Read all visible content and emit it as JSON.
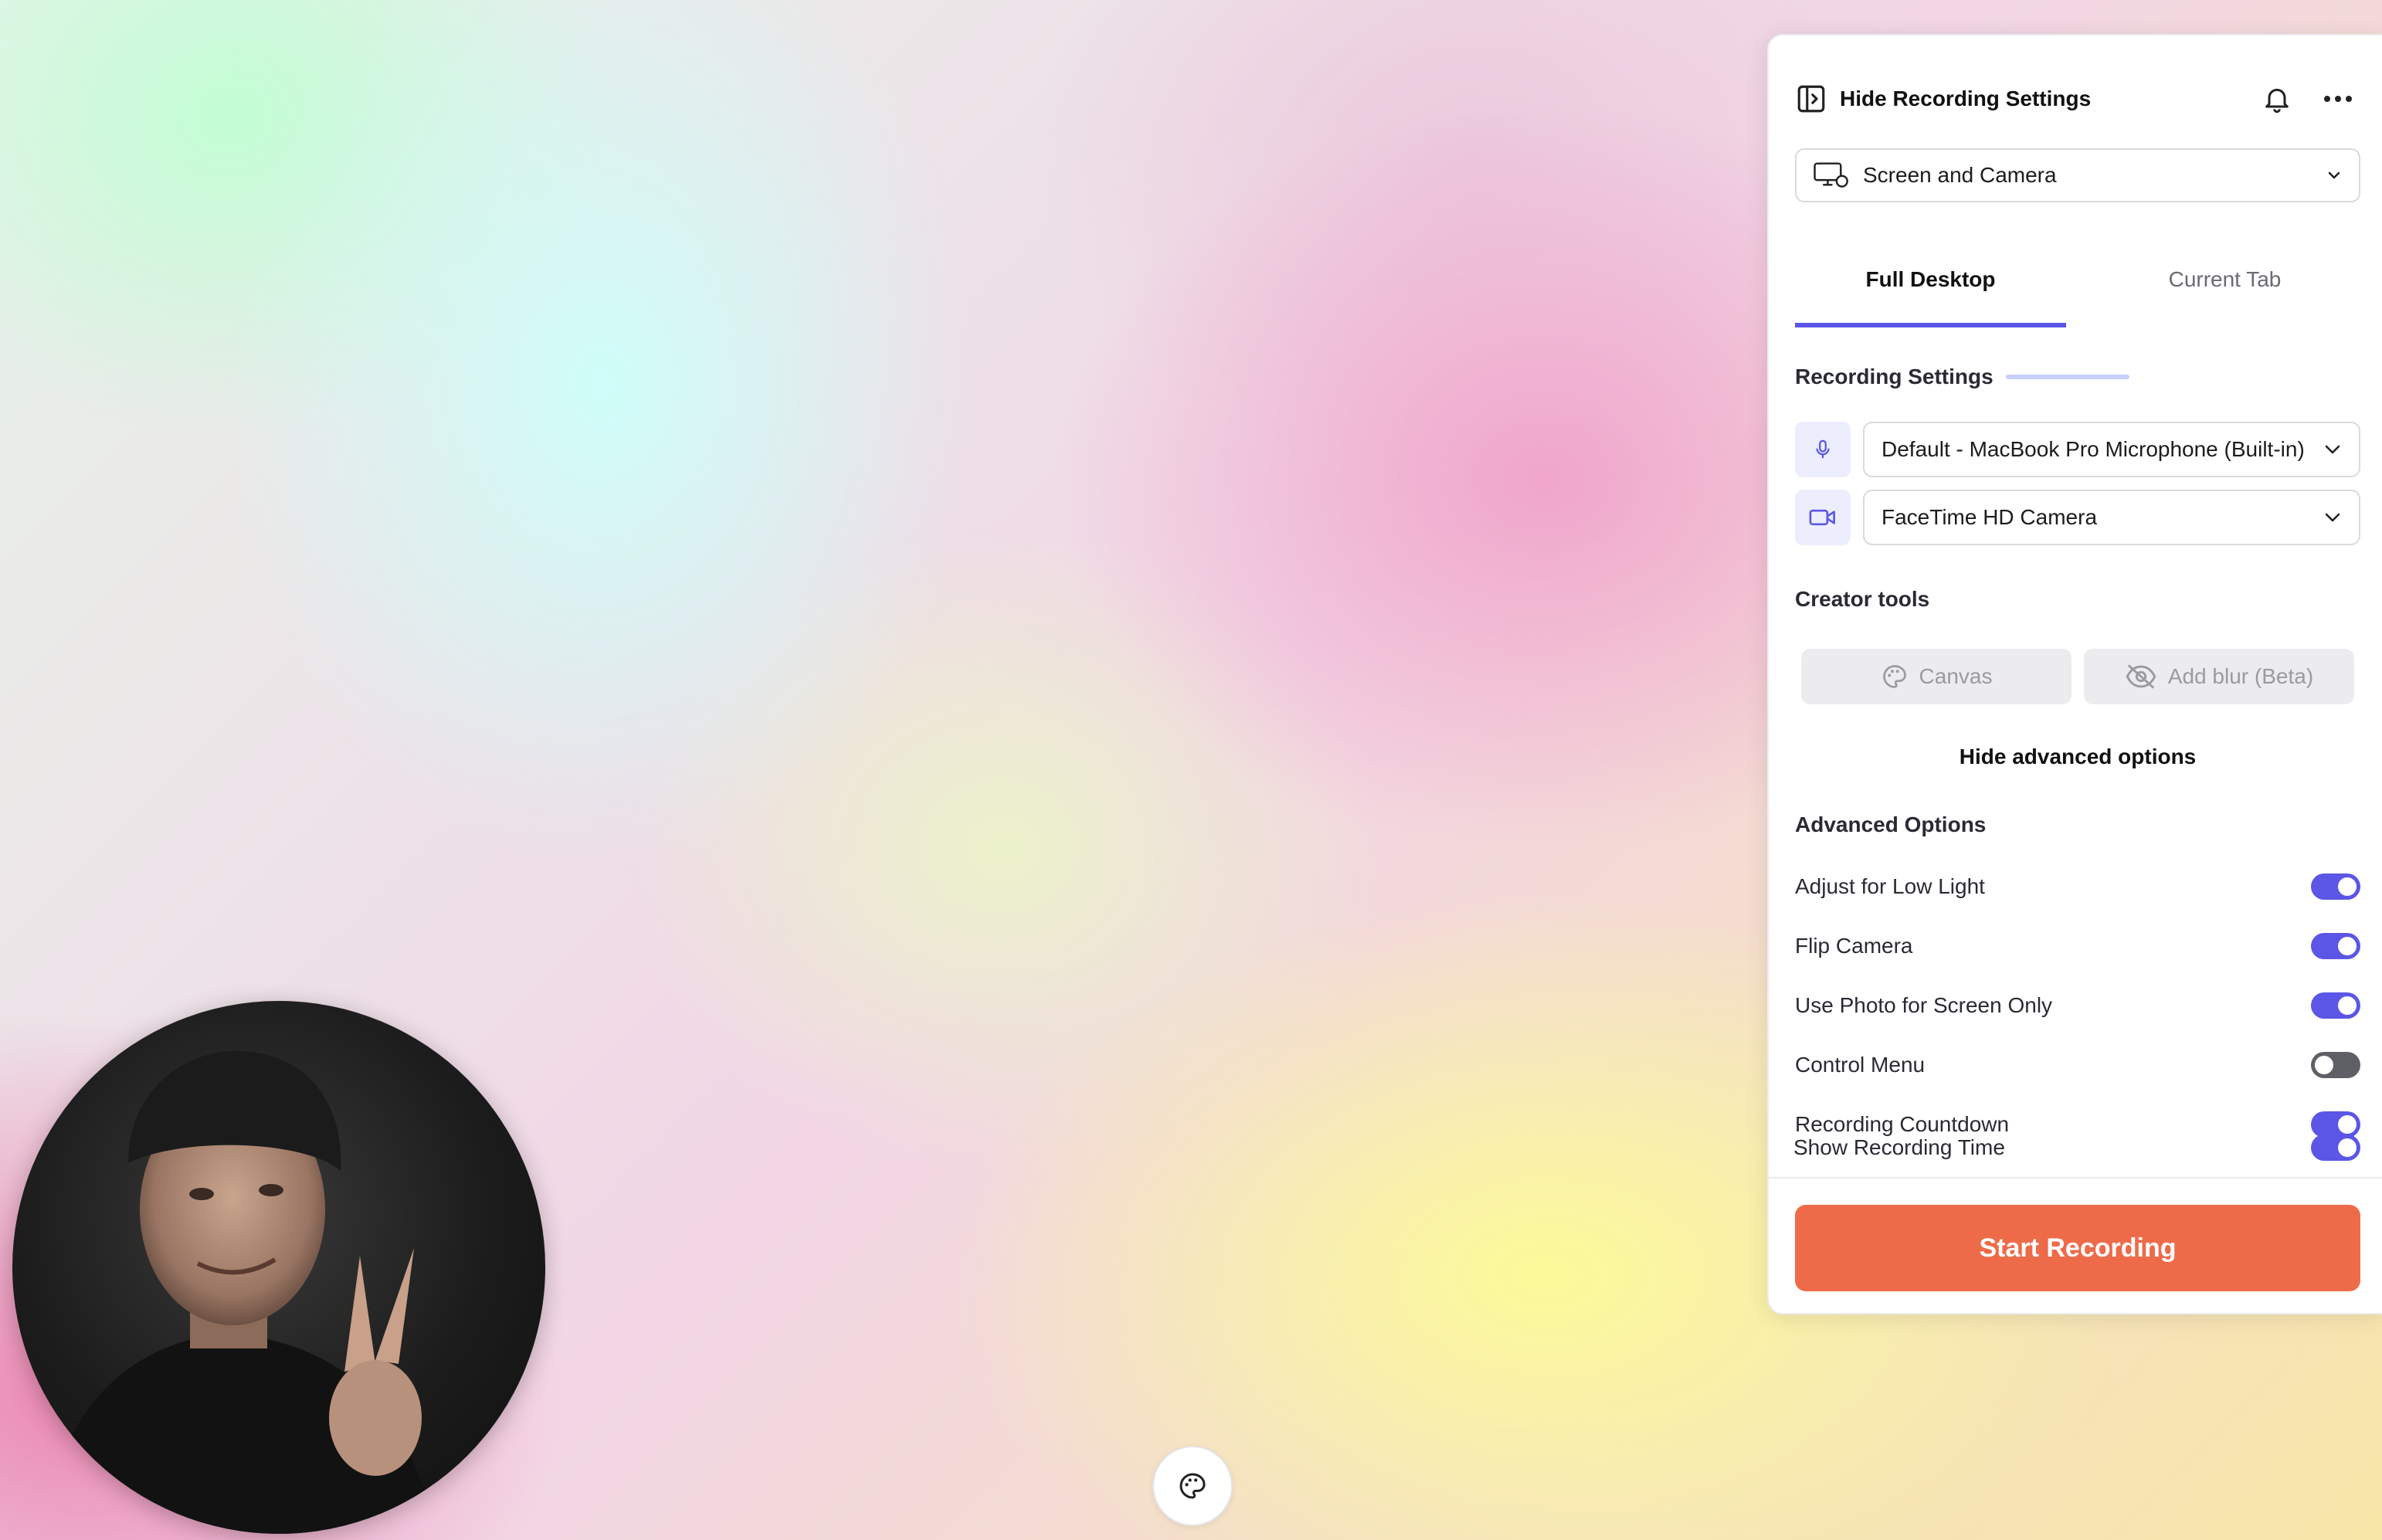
{
  "header": {
    "toggle_label": "Hide Recording Settings"
  },
  "source": {
    "selected": "Screen and Camera"
  },
  "tabs": [
    {
      "label": "Full Desktop"
    },
    {
      "label": "Current Tab"
    }
  ],
  "recording_settings": {
    "title": "Recording Settings",
    "microphone": "Default - MacBook Pro Microphone (Built-in)",
    "camera": "FaceTime HD Camera"
  },
  "creator_tools": {
    "title": "Creator tools",
    "canvas_label": "Canvas",
    "blur_label": "Add blur (Beta)"
  },
  "advanced": {
    "toggle_link": "Hide advanced options",
    "title": "Advanced Options",
    "options": [
      {
        "label": "Adjust for Low Light",
        "enabled": true
      },
      {
        "label": "Flip Camera",
        "enabled": true
      },
      {
        "label": "Use Photo for Screen Only",
        "enabled": true
      },
      {
        "label": "Control Menu",
        "enabled": false
      },
      {
        "label": "Recording Countdown",
        "enabled": true
      },
      {
        "label": "Show Recording Time",
        "enabled": true
      }
    ]
  },
  "start_button": "Start Recording",
  "colors": {
    "accent": "#5b56e6",
    "start": "#ee6b49"
  }
}
